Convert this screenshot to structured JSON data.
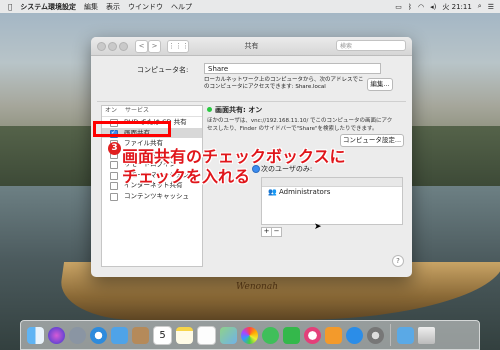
{
  "menubar": {
    "app": "システム環境設定",
    "items": [
      "編集",
      "表示",
      "ウインドウ",
      "ヘルプ"
    ],
    "clock": "火 21:11"
  },
  "window": {
    "title": "共有",
    "search_placeholder": "検索",
    "nav_back": "<",
    "nav_fwd": ">",
    "computer_name_label": "コンピュータ名:",
    "computer_name_value": "Share",
    "network_note": "ローカルネットワーク上のコンピュータから、次のアドレスでこのコンピュータにアクセスできます: Share.local",
    "edit_button": "編集...",
    "services_header_on": "オン",
    "services_header_name": "サービス",
    "services": [
      {
        "name": "DVD または CD 共有",
        "on": false
      },
      {
        "name": "画面共有",
        "on": true,
        "selected": true
      },
      {
        "name": "ファイル共有",
        "on": false
      },
      {
        "name": "プリンタ共有",
        "on": false
      },
      {
        "name": "リモートログイン",
        "on": false
      },
      {
        "name": "リモートマネージメント",
        "on": false
      },
      {
        "name": "インターネット共有",
        "on": false
      },
      {
        "name": "コンテンツキャッシュ",
        "on": false
      }
    ],
    "status": "画面共有: オン",
    "description": "ほかのユーザは、vnc://192.168.11.10/ でこのコンピュータの画面にアクセスしたり、Finder のサイドバーで\"Share\"を検索したりできます。",
    "computer_settings_button": "コンピュータ設定...",
    "access_option": "次のユーザのみ:",
    "users": [
      "Administrators"
    ],
    "add_button": "+",
    "remove_button": "−",
    "help": "?"
  },
  "annotation": {
    "step": "3",
    "line1": "画面共有のチェックボックスに",
    "line2": "チェックを入れる",
    "color": "#e0161b"
  },
  "canoe_text": "Wenonah",
  "dock": {
    "icons": [
      "finder-icon",
      "siri-icon",
      "launchpad-icon",
      "safari-icon",
      "mail-icon",
      "contacts-icon",
      "calendar-icon",
      "notes-icon",
      "reminders-icon",
      "maps-icon",
      "photos-icon",
      "messages-icon",
      "facetime-icon",
      "itunes-icon",
      "books-icon",
      "app-store-icon",
      "system-preferences-icon",
      "downloads-icon",
      "trash-icon"
    ],
    "calendar_day": "5"
  }
}
